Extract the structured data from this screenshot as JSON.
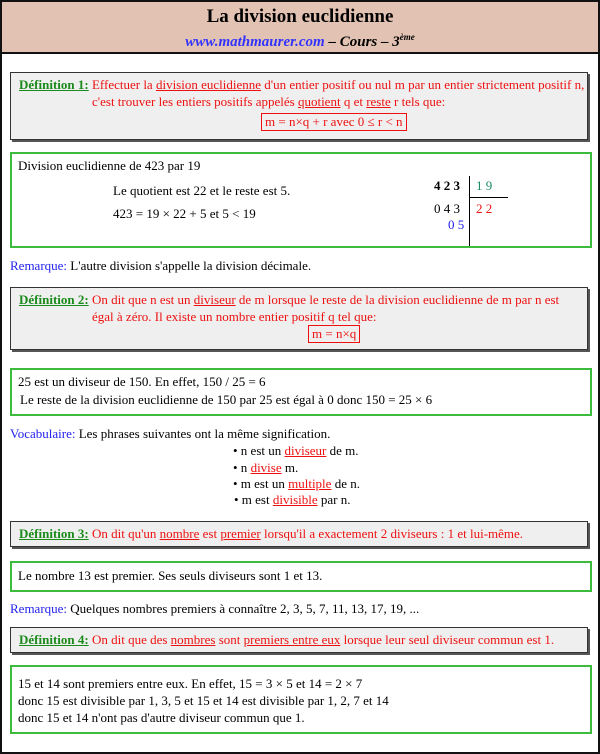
{
  "header": {
    "title": "La division euclidienne",
    "site": "www.mathmaurer.com",
    "sep1": " – Cours – ",
    "level": "3",
    "level_sup": "ème"
  },
  "def1": {
    "label": "Définition 1:",
    "line1_a": " Effectuer la ",
    "line1_u": "division euclidienne",
    "line1_b": " d'un entier positif ou nul m par un entier strictement positif  n,",
    "line2_a": "c'est trouver les entiers positifs appelés ",
    "line2_u1": "quotient",
    "line2_b": " q  et ",
    "line2_u2": "reste",
    "line2_c": " r tels que:",
    "formula": "m = n×q + r avec 0 ≤ r < n"
  },
  "ex1": {
    "title": "Division euclidienne de 423 par 19",
    "line1": "Le quotient est 22  et le reste est 5.",
    "line2": "423 = 19 × 22 + 5  et   5 < 19",
    "division": {
      "dividend": "4 2 3",
      "divisor": "1 9",
      "step": "0 4 3",
      "quotient": "2 2",
      "remainder": "0 5"
    }
  },
  "remark1": {
    "label": "Remarque:",
    "text": " L'autre division s'appelle la division décimale."
  },
  "def2": {
    "label": "Définition 2:",
    "line1_a": " On dit que  n  est un ",
    "line1_u": "diviseur",
    "line1_b": " de  m  lorsque le reste de la division euclidienne de  m  par  n  est",
    "line2": "égal à zéro. Il existe un nombre entier positif  q tel que:",
    "formula": "m = n×q"
  },
  "ex2": {
    "line1": "25 est un diviseur de 150. En effet,   150 / 25 = 6",
    "line2": "Le reste de la division euclidienne de 150 par 25 est égal à 0 donc 150 = 25 × 6"
  },
  "vocab": {
    "label": "Vocabulaire:",
    "text": " Les phrases suivantes ont la même signification.",
    "items": [
      {
        "a": "• n est un ",
        "u": "diviseur",
        "b": " de m."
      },
      {
        "a": "• n ",
        "u": "divise",
        "b": " m."
      },
      {
        "a": "• m est un ",
        "u": "multiple",
        "b": " de n."
      },
      {
        "a": "• m est ",
        "u": "divisible",
        "b": " par n."
      }
    ]
  },
  "def3": {
    "label": "Définition 3:",
    "a": " On dit qu'un ",
    "u1": "nombre",
    "b": " est ",
    "u2": "premier",
    "c": " lorsqu'il a exactement 2 diviseurs : 1  et lui-même."
  },
  "ex3": {
    "text": "Le nombre 13  est premier. Ses seuls diviseurs sont 1 et 13."
  },
  "remark2": {
    "label": "Remarque:",
    "text": " Quelques nombres premiers à connaître  2, 3, 5, 7, 11, 13, 17, 19, ..."
  },
  "def4": {
    "label": "Définition 4:",
    "a": " On dit que des ",
    "u1": "nombres",
    "b": " sont ",
    "u2": "premiers entre eux",
    "c": " lorsque leur seul diviseur commun est 1."
  },
  "ex4": {
    "line1": "15 et  14 sont premiers entre eux. En effet, 15 = 3 × 5  et  14 = 2 × 7",
    "line2": "donc 15 est divisible par 1, 3, 5 et 15  et  14 est divisible par 1, 2, 7 et 14",
    "line3": "donc 15 et 14 n'ont pas d'autre diviseur commun que 1."
  }
}
